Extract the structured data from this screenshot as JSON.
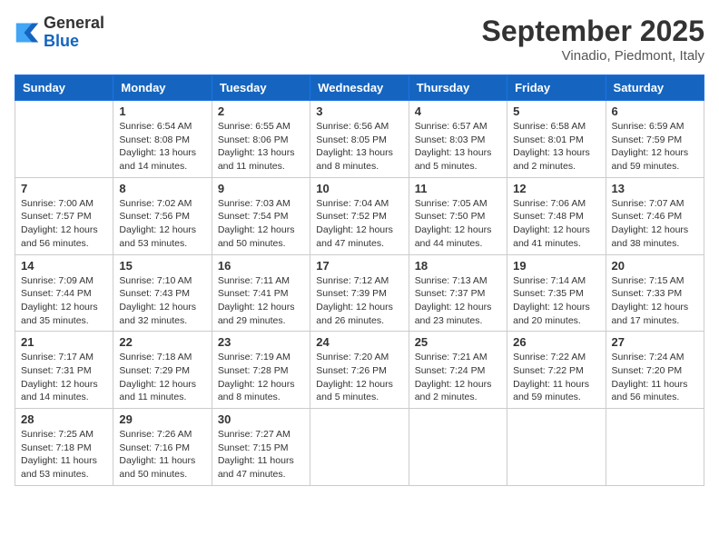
{
  "header": {
    "logo_general": "General",
    "logo_blue": "Blue",
    "month_title": "September 2025",
    "location": "Vinadio, Piedmont, Italy"
  },
  "days_of_week": [
    "Sunday",
    "Monday",
    "Tuesday",
    "Wednesday",
    "Thursday",
    "Friday",
    "Saturday"
  ],
  "weeks": [
    [
      {
        "day": "",
        "info": ""
      },
      {
        "day": "1",
        "info": "Sunrise: 6:54 AM\nSunset: 8:08 PM\nDaylight: 13 hours\nand 14 minutes."
      },
      {
        "day": "2",
        "info": "Sunrise: 6:55 AM\nSunset: 8:06 PM\nDaylight: 13 hours\nand 11 minutes."
      },
      {
        "day": "3",
        "info": "Sunrise: 6:56 AM\nSunset: 8:05 PM\nDaylight: 13 hours\nand 8 minutes."
      },
      {
        "day": "4",
        "info": "Sunrise: 6:57 AM\nSunset: 8:03 PM\nDaylight: 13 hours\nand 5 minutes."
      },
      {
        "day": "5",
        "info": "Sunrise: 6:58 AM\nSunset: 8:01 PM\nDaylight: 13 hours\nand 2 minutes."
      },
      {
        "day": "6",
        "info": "Sunrise: 6:59 AM\nSunset: 7:59 PM\nDaylight: 12 hours\nand 59 minutes."
      }
    ],
    [
      {
        "day": "7",
        "info": "Sunrise: 7:00 AM\nSunset: 7:57 PM\nDaylight: 12 hours\nand 56 minutes."
      },
      {
        "day": "8",
        "info": "Sunrise: 7:02 AM\nSunset: 7:56 PM\nDaylight: 12 hours\nand 53 minutes."
      },
      {
        "day": "9",
        "info": "Sunrise: 7:03 AM\nSunset: 7:54 PM\nDaylight: 12 hours\nand 50 minutes."
      },
      {
        "day": "10",
        "info": "Sunrise: 7:04 AM\nSunset: 7:52 PM\nDaylight: 12 hours\nand 47 minutes."
      },
      {
        "day": "11",
        "info": "Sunrise: 7:05 AM\nSunset: 7:50 PM\nDaylight: 12 hours\nand 44 minutes."
      },
      {
        "day": "12",
        "info": "Sunrise: 7:06 AM\nSunset: 7:48 PM\nDaylight: 12 hours\nand 41 minutes."
      },
      {
        "day": "13",
        "info": "Sunrise: 7:07 AM\nSunset: 7:46 PM\nDaylight: 12 hours\nand 38 minutes."
      }
    ],
    [
      {
        "day": "14",
        "info": "Sunrise: 7:09 AM\nSunset: 7:44 PM\nDaylight: 12 hours\nand 35 minutes."
      },
      {
        "day": "15",
        "info": "Sunrise: 7:10 AM\nSunset: 7:43 PM\nDaylight: 12 hours\nand 32 minutes."
      },
      {
        "day": "16",
        "info": "Sunrise: 7:11 AM\nSunset: 7:41 PM\nDaylight: 12 hours\nand 29 minutes."
      },
      {
        "day": "17",
        "info": "Sunrise: 7:12 AM\nSunset: 7:39 PM\nDaylight: 12 hours\nand 26 minutes."
      },
      {
        "day": "18",
        "info": "Sunrise: 7:13 AM\nSunset: 7:37 PM\nDaylight: 12 hours\nand 23 minutes."
      },
      {
        "day": "19",
        "info": "Sunrise: 7:14 AM\nSunset: 7:35 PM\nDaylight: 12 hours\nand 20 minutes."
      },
      {
        "day": "20",
        "info": "Sunrise: 7:15 AM\nSunset: 7:33 PM\nDaylight: 12 hours\nand 17 minutes."
      }
    ],
    [
      {
        "day": "21",
        "info": "Sunrise: 7:17 AM\nSunset: 7:31 PM\nDaylight: 12 hours\nand 14 minutes."
      },
      {
        "day": "22",
        "info": "Sunrise: 7:18 AM\nSunset: 7:29 PM\nDaylight: 12 hours\nand 11 minutes."
      },
      {
        "day": "23",
        "info": "Sunrise: 7:19 AM\nSunset: 7:28 PM\nDaylight: 12 hours\nand 8 minutes."
      },
      {
        "day": "24",
        "info": "Sunrise: 7:20 AM\nSunset: 7:26 PM\nDaylight: 12 hours\nand 5 minutes."
      },
      {
        "day": "25",
        "info": "Sunrise: 7:21 AM\nSunset: 7:24 PM\nDaylight: 12 hours\nand 2 minutes."
      },
      {
        "day": "26",
        "info": "Sunrise: 7:22 AM\nSunset: 7:22 PM\nDaylight: 11 hours\nand 59 minutes."
      },
      {
        "day": "27",
        "info": "Sunrise: 7:24 AM\nSunset: 7:20 PM\nDaylight: 11 hours\nand 56 minutes."
      }
    ],
    [
      {
        "day": "28",
        "info": "Sunrise: 7:25 AM\nSunset: 7:18 PM\nDaylight: 11 hours\nand 53 minutes."
      },
      {
        "day": "29",
        "info": "Sunrise: 7:26 AM\nSunset: 7:16 PM\nDaylight: 11 hours\nand 50 minutes."
      },
      {
        "day": "30",
        "info": "Sunrise: 7:27 AM\nSunset: 7:15 PM\nDaylight: 11 hours\nand 47 minutes."
      },
      {
        "day": "",
        "info": ""
      },
      {
        "day": "",
        "info": ""
      },
      {
        "day": "",
        "info": ""
      },
      {
        "day": "",
        "info": ""
      }
    ]
  ]
}
